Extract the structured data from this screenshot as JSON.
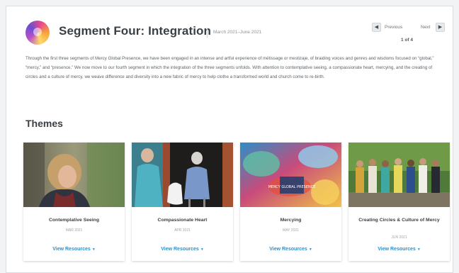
{
  "header": {
    "title": "Segment Four: Integration",
    "date_range": "March 2021–June 2021"
  },
  "pager": {
    "previous_label": "Previous",
    "next_label": "Next",
    "prev_icon": "chevron-left-icon",
    "next_icon": "chevron-right-icon",
    "count": "1 of 4"
  },
  "intro": "Through the first three segments of Mercy Global Presence, we have been engaged in an intense and artful experience of métissage or mestizaje, of braiding voices and genres and wisdoms focused on “global,” “mercy,” and “presence.” We now move to our fourth segment in which the integration of the three segments unfolds. With attention to contemplative seeing, a compassionate heart, mercying, and the creating of circles and a culture of mercy, we weave difference and diversity into a new fabric of mercy to help clothe a transformed world and church come to re-birth.",
  "themes": {
    "heading": "Themes",
    "cards": [
      {
        "title": "Contemplative Seeing",
        "date": "MAR 2021",
        "link": "View Resources"
      },
      {
        "title": "Compassionate Heart",
        "date": "APR 2021",
        "link": "View Resources"
      },
      {
        "title": "Mercying",
        "date": "MAY 2021",
        "link": "View Resources"
      },
      {
        "title": "Creating Circles & Culture of Mercy",
        "date": "JUN 2021",
        "link": "View Resources"
      }
    ],
    "mural_text": "MERCY GLOBAL PRESENCE"
  },
  "colors": {
    "accent": "#2f8fc9",
    "title": "#3a3f44"
  }
}
